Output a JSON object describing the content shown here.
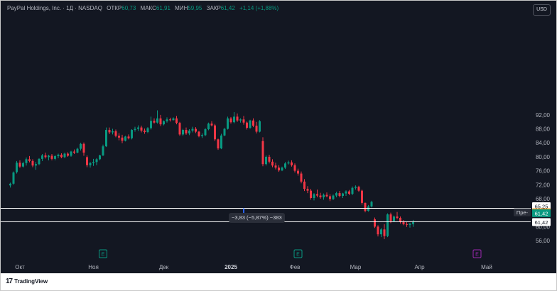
{
  "header": {
    "symbol": "PayPal Holdings, Inc. · 1Д · NASDAQ",
    "open_label": "ОТКР",
    "open_value": "60,73",
    "high_label": "МАКС",
    "high_value": "61,91",
    "low_label": "МИН",
    "low_value": "59,95",
    "close_label": "ЗАКР",
    "close_value": "61,42",
    "change": "+1,14 (+1,88%)",
    "currency": "USD"
  },
  "price_axis": [
    "92,00",
    "88,00",
    "84,00",
    "80,00",
    "76,00",
    "72,00",
    "68,00",
    "60,00",
    "56,00"
  ],
  "time_axis": [
    {
      "label": "Окт",
      "index": 3
    },
    {
      "label": "Ноя",
      "index": 26
    },
    {
      "label": "Дек",
      "index": 48
    },
    {
      "label": "2025",
      "index": 69,
      "bold": true
    },
    {
      "label": "Фев",
      "index": 89
    },
    {
      "label": "Мар",
      "index": 108
    },
    {
      "label": "Апр",
      "index": 128
    },
    {
      "label": "Май",
      "index": 149
    }
  ],
  "earnings_markers": [
    {
      "index": 29,
      "label": "E",
      "color": "#089981"
    },
    {
      "index": 90,
      "label": "E",
      "color": "#089981"
    },
    {
      "index": 146,
      "label": "E",
      "color": "#9c27b0"
    }
  ],
  "horizontal_lines": [
    {
      "value": 65.25,
      "label": "65,25",
      "badge_bg": "#ffffff",
      "badge_fg": "#131722"
    },
    {
      "value": 61.42,
      "label": "61,42",
      "badge_bg": "#ffffff",
      "badge_fg": "#131722"
    }
  ],
  "price_badges": [
    {
      "value": 62.67,
      "label": "62,67",
      "prefix": "Пре-",
      "bg": "#f7931a",
      "fg": "#ffffff"
    },
    {
      "value": 61.42,
      "label": "61,42",
      "prefix": "",
      "bg": "#089981",
      "fg": "#ffffff"
    }
  ],
  "measure": {
    "text": "−3,83 (−5,87%) −383",
    "index": 73
  },
  "footer": {
    "logo": "TradingView"
  },
  "colors": {
    "up": "#089981",
    "down": "#f23645",
    "line": "#ffffff",
    "measure": "#2962ff"
  },
  "chart_data": {
    "type": "candlestick",
    "y_ticks": [
      92,
      88,
      84,
      80,
      76,
      72,
      68,
      60,
      56
    ],
    "candles": [
      [
        71.8,
        72.6,
        71.2,
        72.3
      ],
      [
        72.3,
        75.8,
        72.0,
        75.5
      ],
      [
        75.6,
        78.8,
        75.2,
        78.3
      ],
      [
        78.3,
        79.0,
        76.8,
        77.2
      ],
      [
        77.2,
        78.6,
        76.9,
        78.2
      ],
      [
        78.2,
        79.8,
        77.5,
        79.3
      ],
      [
        79.3,
        80.2,
        78.4,
        78.8
      ],
      [
        78.8,
        79.3,
        77.0,
        77.5
      ],
      [
        77.5,
        78.5,
        76.3,
        77.9
      ],
      [
        77.9,
        79.6,
        77.6,
        79.4
      ],
      [
        79.4,
        80.8,
        78.8,
        80.4
      ],
      [
        80.4,
        81.2,
        79.5,
        79.9
      ],
      [
        79.9,
        80.6,
        79.0,
        80.3
      ],
      [
        80.3,
        80.8,
        79.0,
        79.4
      ],
      [
        79.4,
        80.5,
        79.0,
        80.2
      ],
      [
        80.2,
        80.9,
        79.6,
        80.6
      ],
      [
        80.6,
        81.0,
        79.6,
        79.9
      ],
      [
        79.9,
        81.2,
        79.6,
        80.9
      ],
      [
        80.9,
        81.3,
        80.0,
        80.3
      ],
      [
        80.3,
        81.7,
        80.0,
        81.5
      ],
      [
        81.5,
        82.1,
        80.8,
        81.2
      ],
      [
        81.2,
        82.6,
        81.0,
        82.3
      ],
      [
        82.3,
        84.0,
        81.8,
        83.7
      ],
      [
        83.7,
        84.1,
        80.3,
        81.2
      ],
      [
        79.9,
        80.4,
        77.0,
        77.6
      ],
      [
        77.6,
        78.5,
        76.9,
        78.2
      ],
      [
        78.2,
        79.4,
        77.4,
        78.5
      ],
      [
        78.5,
        79.6,
        77.6,
        79.3
      ],
      [
        79.3,
        80.6,
        79.0,
        80.4
      ],
      [
        80.4,
        83.5,
        80.2,
        83.0
      ],
      [
        83.0,
        88.4,
        82.8,
        87.7
      ],
      [
        87.7,
        88.4,
        86.5,
        87.0
      ],
      [
        87.0,
        88.0,
        86.4,
        87.3
      ],
      [
        87.3,
        87.8,
        85.6,
        86.0
      ],
      [
        86.0,
        86.8,
        84.7,
        85.5
      ],
      [
        85.5,
        86.3,
        83.9,
        84.6
      ],
      [
        84.6,
        86.0,
        84.4,
        85.8
      ],
      [
        85.8,
        86.4,
        85.0,
        85.3
      ],
      [
        85.3,
        87.9,
        85.0,
        87.7
      ],
      [
        87.7,
        88.6,
        87.2,
        88.0
      ],
      [
        88.0,
        89.0,
        87.4,
        88.4
      ],
      [
        88.4,
        88.9,
        87.0,
        87.5
      ],
      [
        87.5,
        88.1,
        86.6,
        87.1
      ],
      [
        87.1,
        88.5,
        86.8,
        88.2
      ],
      [
        88.2,
        91.5,
        87.8,
        90.3
      ],
      [
        90.3,
        91.0,
        89.5,
        89.8
      ],
      [
        89.8,
        93.3,
        89.5,
        91.0
      ],
      [
        91.0,
        92.0,
        88.8,
        89.3
      ],
      [
        89.3,
        90.4,
        89.0,
        90.2
      ],
      [
        90.2,
        91.3,
        89.8,
        90.7
      ],
      [
        90.7,
        91.2,
        90.1,
        90.5
      ],
      [
        90.5,
        91.3,
        90.4,
        91.0
      ],
      [
        91.0,
        91.7,
        89.3,
        89.7
      ],
      [
        89.7,
        90.0,
        86.0,
        86.4
      ],
      [
        86.4,
        88.0,
        86.0,
        87.7
      ],
      [
        87.7,
        88.4,
        86.3,
        86.7
      ],
      [
        86.7,
        87.9,
        86.2,
        87.5
      ],
      [
        87.5,
        88.6,
        87.0,
        88.0
      ],
      [
        88.0,
        88.5,
        86.8,
        87.2
      ],
      [
        87.2,
        87.4,
        85.6,
        85.9
      ],
      [
        85.9,
        86.7,
        85.4,
        86.2
      ],
      [
        86.2,
        88.2,
        85.9,
        87.9
      ],
      [
        87.9,
        89.8,
        87.6,
        89.5
      ],
      [
        89.5,
        90.2,
        88.7,
        89.0
      ],
      [
        89.0,
        89.4,
        84.5,
        85.0
      ],
      [
        85.0,
        85.2,
        82.0,
        82.4
      ],
      [
        82.4,
        86.6,
        82.2,
        86.1
      ],
      [
        86.1,
        88.3,
        85.9,
        88.0
      ],
      [
        88.0,
        91.5,
        87.8,
        91.0
      ],
      [
        91.0,
        91.4,
        89.5,
        89.9
      ],
      [
        89.9,
        92.8,
        89.6,
        91.5
      ],
      [
        91.5,
        92.4,
        90.0,
        90.4
      ],
      [
        90.4,
        91.0,
        89.8,
        90.7
      ],
      [
        90.7,
        91.7,
        89.2,
        89.8
      ],
      [
        89.8,
        90.1,
        87.8,
        88.3
      ],
      [
        88.3,
        90.6,
        88.0,
        90.4
      ],
      [
        90.4,
        91.0,
        88.5,
        88.9
      ],
      [
        88.9,
        90.0,
        86.7,
        87.2
      ],
      [
        87.2,
        90.5,
        87.0,
        90.2
      ],
      [
        84.5,
        85.6,
        77.3,
        77.9
      ],
      [
        77.9,
        80.4,
        77.5,
        80.0
      ],
      [
        80.0,
        80.6,
        78.1,
        78.6
      ],
      [
        78.6,
        79.3,
        77.0,
        77.5
      ],
      [
        77.5,
        78.3,
        76.4,
        76.9
      ],
      [
        76.9,
        77.6,
        75.7,
        76.1
      ],
      [
        76.1,
        77.2,
        75.9,
        76.9
      ],
      [
        76.9,
        78.5,
        76.5,
        78.1
      ],
      [
        78.1,
        78.9,
        77.8,
        78.4
      ],
      [
        78.4,
        79.0,
        77.2,
        77.6
      ],
      [
        77.6,
        78.1,
        75.5,
        76.0
      ],
      [
        76.0,
        76.6,
        74.6,
        75.2
      ],
      [
        75.2,
        75.8,
        72.4,
        72.9
      ],
      [
        72.9,
        73.6,
        70.2,
        70.8
      ],
      [
        70.8,
        71.6,
        69.6,
        70.3
      ],
      [
        70.3,
        70.8,
        67.7,
        68.2
      ],
      [
        68.2,
        69.6,
        67.5,
        69.3
      ],
      [
        69.3,
        70.6,
        68.4,
        68.9
      ],
      [
        68.9,
        69.7,
        68.0,
        68.4
      ],
      [
        68.4,
        69.5,
        67.7,
        69.1
      ],
      [
        69.1,
        69.8,
        68.4,
        68.7
      ],
      [
        68.7,
        69.3,
        67.3,
        67.9
      ],
      [
        67.9,
        69.2,
        67.6,
        68.9
      ],
      [
        68.9,
        70.0,
        68.4,
        69.6
      ],
      [
        69.6,
        70.2,
        68.4,
        68.8
      ],
      [
        68.8,
        69.7,
        68.2,
        69.5
      ],
      [
        69.5,
        70.4,
        68.8,
        70.1
      ],
      [
        70.1,
        70.5,
        69.0,
        69.4
      ],
      [
        69.4,
        71.5,
        69.0,
        71.1
      ],
      [
        71.1,
        71.8,
        70.6,
        71.4
      ],
      [
        71.4,
        71.7,
        70.0,
        70.3
      ],
      [
        70.3,
        70.6,
        66.3,
        66.8
      ],
      [
        66.8,
        66.9,
        64.1,
        64.5
      ],
      [
        64.5,
        66.2,
        64.3,
        65.8
      ],
      [
        65.8,
        67.4,
        65.5,
        67.1
      ],
      [
        62.1,
        62.6,
        59.6,
        60.0
      ],
      [
        60.0,
        60.4,
        57.2,
        57.8
      ],
      [
        57.8,
        59.6,
        57.0,
        59.2
      ],
      [
        59.2,
        60.7,
        56.4,
        57.3
      ],
      [
        57.3,
        63.8,
        57.0,
        63.5
      ],
      [
        63.5,
        64.0,
        61.0,
        61.6
      ],
      [
        61.6,
        63.2,
        61.3,
        62.9
      ],
      [
        62.9,
        64.2,
        62.1,
        62.5
      ],
      [
        62.5,
        62.9,
        60.9,
        61.3
      ],
      [
        61.3,
        61.9,
        60.4,
        60.7
      ],
      [
        60.7,
        61.4,
        59.9,
        60.5
      ],
      [
        60.5,
        61.0,
        59.7,
        60.9
      ],
      [
        60.73,
        61.91,
        59.95,
        61.42
      ]
    ]
  }
}
